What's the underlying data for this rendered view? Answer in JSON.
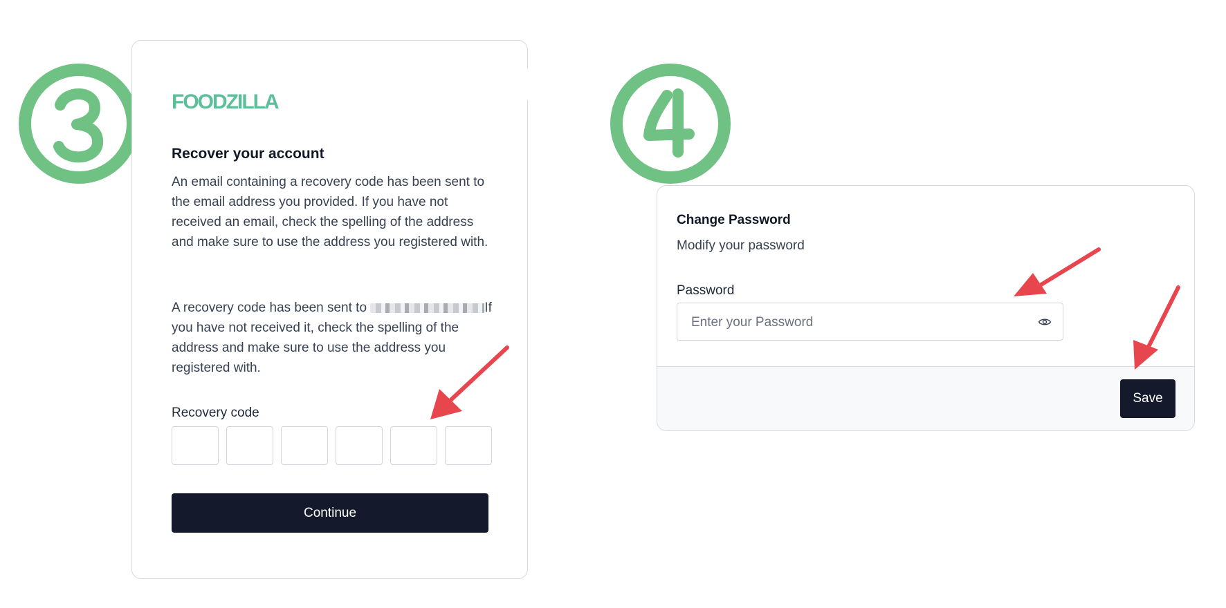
{
  "colors": {
    "step_badge": "#6fc283",
    "arrow": "#e8464f",
    "logo": "#5cbf9a",
    "button_bg": "#141a2b"
  },
  "steps": [
    {
      "number": "3"
    },
    {
      "number": "4"
    }
  ],
  "recover": {
    "logo": "FOODZILLA",
    "heading": "Recover your account",
    "paragraph1": "An email containing a recovery code has been sent to the email address you provided. If you have not received an email, check the spelling of the address and make sure to use the address you registered with.",
    "paragraph2_before": "A recovery code has been sent to ",
    "paragraph2_after": "If you have not received it, check the spelling of the address and make sure to use the address you registered with.",
    "code_label": "Recovery code",
    "code_digits": [
      "",
      "",
      "",
      "",
      "",
      ""
    ],
    "continue_label": "Continue"
  },
  "change_password": {
    "title": "Change Password",
    "subtitle": "Modify your password",
    "password_label": "Password",
    "password_placeholder": "Enter your Password",
    "password_value": "",
    "reveal_icon": "eye-icon",
    "save_label": "Save"
  }
}
